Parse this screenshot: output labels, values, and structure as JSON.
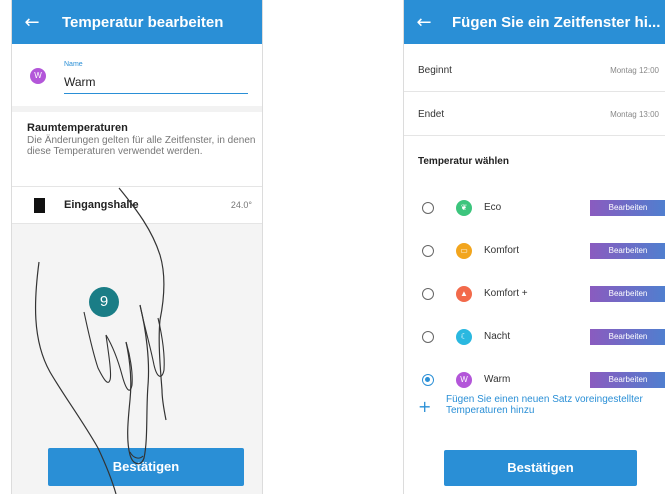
{
  "left": {
    "title": "Temperatur bearbeiten",
    "back_glyph": "←",
    "name_label": "Name",
    "name_value": "Warm",
    "avatar_letter": "W",
    "section_title": "Raumtemperaturen",
    "section_desc": "Die Änderungen gelten für alle Zeitfenster, in denen diese Temperaturen verwendet werden.",
    "room": {
      "name": "Eingangshalle",
      "temp": "24.0°",
      "icon": "door-icon"
    },
    "confirm_label": "Bestätigen",
    "step_number": "9"
  },
  "right": {
    "title": "Fügen Sie ein Zeitfenster hi...",
    "back_glyph": "←",
    "start_label": "Beginnt",
    "start_value": "Montag 12:00",
    "end_label": "Endet",
    "end_value": "Montag 13:00",
    "choose_label": "Temperatur wählen",
    "options": [
      {
        "label": "Eco",
        "icon": "leaf-icon",
        "color": "#3cc57d",
        "selected": false,
        "edit": "Bearbeiten"
      },
      {
        "label": "Komfort",
        "icon": "sofa-icon",
        "color": "#f2a51d",
        "selected": false,
        "edit": "Bearbeiten"
      },
      {
        "label": "Komfort +",
        "icon": "flame-icon",
        "color": "#f26a4b",
        "selected": false,
        "edit": "Bearbeiten"
      },
      {
        "label": "Nacht",
        "icon": "moon-icon",
        "color": "#2ab8e0",
        "selected": false,
        "edit": "Bearbeiten"
      },
      {
        "label": "Warm",
        "icon": "w-avatar-icon",
        "letter": "W",
        "color": "#b356d9",
        "selected": true,
        "edit": "Bearbeiten"
      }
    ],
    "add_text": "Fügen Sie einen neuen Satz voreingestellter Temperaturen hinzu",
    "add_glyph": "+",
    "confirm_label": "Bestätigen"
  },
  "colors": {
    "primary": "#2a8fd6",
    "badge": "#1a7d86"
  }
}
